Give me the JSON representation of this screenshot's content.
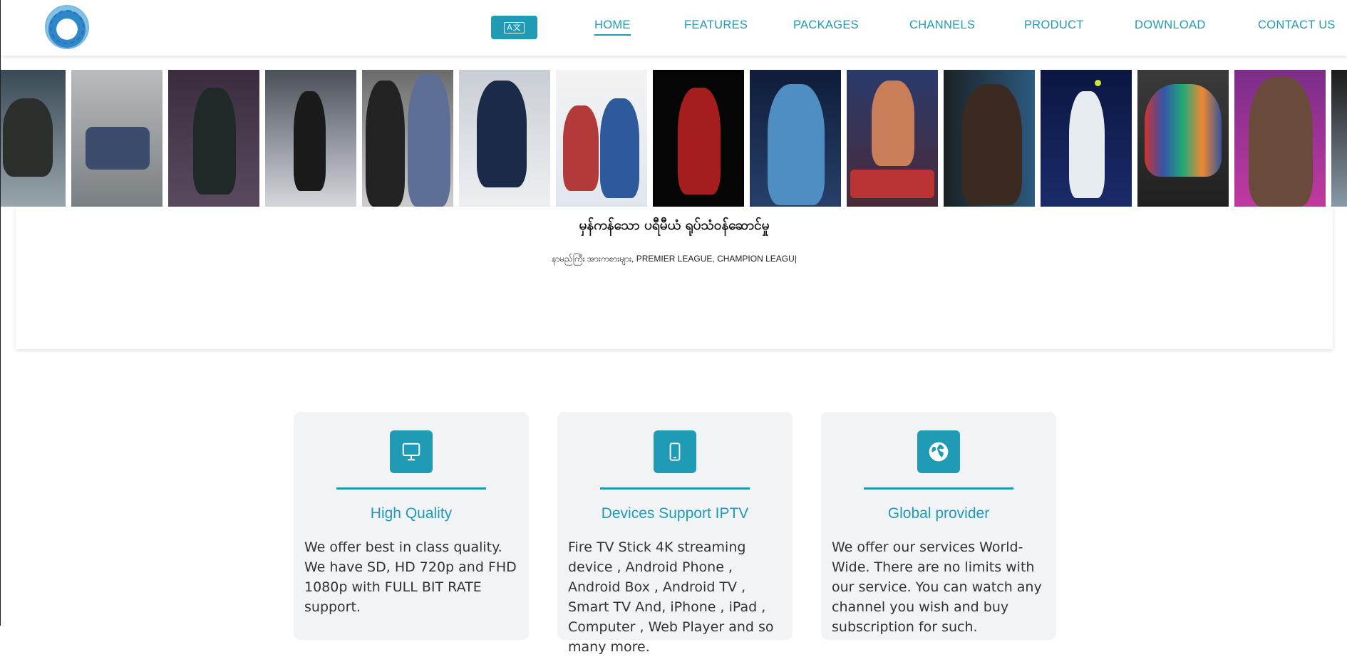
{
  "header": {
    "language_button_label": "A文",
    "nav": [
      {
        "label": "HOME",
        "active": true
      },
      {
        "label": "FEATURES",
        "active": false
      },
      {
        "label": "PACKAGES",
        "active": false
      },
      {
        "label": "CHANNELS",
        "active": false
      },
      {
        "label": "PRODUCT",
        "active": false
      },
      {
        "label": "DOWNLOAD",
        "active": false
      },
      {
        "label": "CONTACT US",
        "active": false
      }
    ]
  },
  "strip": {
    "tiles": [
      "bobsled-athlete",
      "race-cars",
      "motocross-rider",
      "figure-skater",
      "golf-players",
      "hockey-player",
      "baseball-players",
      "basketball-dunk",
      "soccer-players",
      "boxing-legends",
      "fighter-portrait",
      "tennis-serve",
      "football-team-poster",
      "wrestling-champion",
      "partial-tile"
    ]
  },
  "banner": {
    "title": "မှန်ကန်သော ပရီမီယံ ရုပ်သံဝန်ဆောင်မှု",
    "subtitle": "နာမည်ကြီး အားကစားများ, PREMIER LEAGUE, CHAMPION LEAGU|"
  },
  "features": [
    {
      "icon": "monitor-icon",
      "title": "High Quality",
      "text": "We offer best in class quality. We have SD, HD 720p and FHD 1080p with FULL BIT RATE support."
    },
    {
      "icon": "mobile-phone-icon",
      "title": "Devices Support IPTV",
      "text": "Fire TV Stick 4K streaming device , Android Phone , Android Box , Android TV , Smart TV And, iPhone , iPad , Computer , Web Player and so many more."
    },
    {
      "icon": "globe-icon",
      "title": "Global provider",
      "text": "We offer our services World-Wide. There are no limits with our service. You can watch any channel you wish and buy subscription for such."
    }
  ],
  "colors": {
    "accent": "#1f9bb6",
    "card_background": "#f2f3f5"
  }
}
